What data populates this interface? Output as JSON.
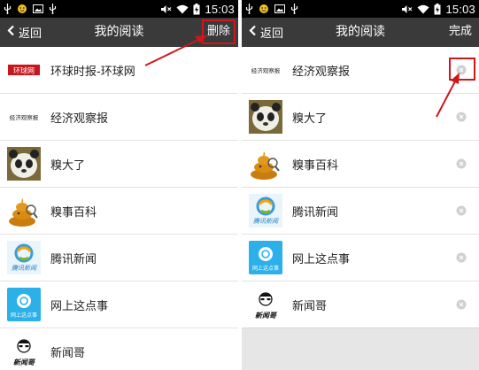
{
  "status_bar": {
    "time": "15:03",
    "icons": [
      "usb-icon",
      "face-icon",
      "image-icon",
      "usb-icon",
      "mute-icon",
      "wifi-icon",
      "battery-charging-icon"
    ]
  },
  "left_screen": {
    "back_label": "返回",
    "title": "我的阅读",
    "action_label": "删除",
    "items": [
      {
        "label": "环球时报-环球网",
        "thumb": "环球网",
        "icon": "huanqiu-logo-icon"
      },
      {
        "label": "经济观察报",
        "thumb": "经济观察报",
        "icon": "eeo-logo-icon"
      },
      {
        "label": "糗大了",
        "icon": "panda-icon"
      },
      {
        "label": "糗事百科",
        "icon": "poop-mascot-icon"
      },
      {
        "label": "腾讯新闻",
        "thumb": "腾讯新闻",
        "icon": "tencent-news-icon"
      },
      {
        "label": "网上这点事",
        "thumb": "网上这点事",
        "icon": "wangshang-icon"
      },
      {
        "label": "新闻哥",
        "thumb": "新闻哥",
        "icon": "xinwenge-icon"
      }
    ]
  },
  "right_screen": {
    "back_label": "返回",
    "title": "我的阅读",
    "action_label": "完成",
    "items": [
      {
        "label": "经济观察报",
        "thumb": "经济观察报",
        "icon": "eeo-logo-icon"
      },
      {
        "label": "糗大了",
        "icon": "panda-icon"
      },
      {
        "label": "糗事百科",
        "icon": "poop-mascot-icon"
      },
      {
        "label": "腾讯新闻",
        "thumb": "腾讯新闻",
        "icon": "tencent-news-icon"
      },
      {
        "label": "网上这点事",
        "thumb": "网上这点事",
        "icon": "wangshang-icon"
      },
      {
        "label": "新闻哥",
        "thumb": "新闻哥",
        "icon": "xinwenge-icon"
      }
    ]
  },
  "colors": {
    "status_bar": "#000000",
    "title_bar": "#3a3a3a",
    "annotation_red": "#d0161a",
    "divider": "#e2e2e2",
    "empty_area": "#e6e6e6"
  }
}
